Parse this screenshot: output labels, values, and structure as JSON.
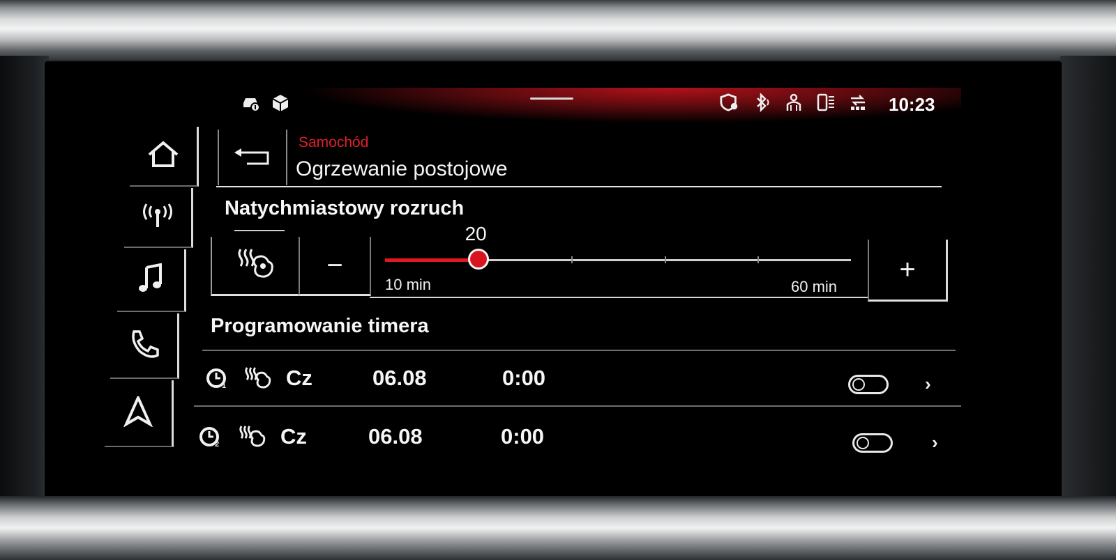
{
  "status_bar": {
    "left_icons": [
      "car-info-icon",
      "package-icon"
    ],
    "right_icons": [
      "shield-location-icon",
      "bluetooth-icon",
      "person-icon",
      "phone-signal-icon",
      "data-transfer-icon"
    ],
    "time": "10:23",
    "accent_color": "#e01822"
  },
  "nav": {
    "items": [
      {
        "icon": "home-icon"
      },
      {
        "icon": "radio-icon"
      },
      {
        "icon": "music-icon"
      },
      {
        "icon": "phone-icon"
      },
      {
        "icon": "navigation-icon"
      }
    ]
  },
  "header": {
    "breadcrumb": "Samochód",
    "title": "Ogrzewanie postojowe",
    "back_icon": "back-arrow-icon"
  },
  "instant_start": {
    "title": "Natychmiastowy rozruch",
    "mode_icon": "seat-heating-icon",
    "minus_label": "−",
    "plus_label": "+",
    "slider": {
      "value": "20",
      "value_num": 20,
      "min": 10,
      "max": 60,
      "min_label": "10 min",
      "max_label": "60 min"
    }
  },
  "timer": {
    "title": "Programowanie timera",
    "rows": [
      {
        "clock_icon": "timer-1-icon",
        "mode_icon": "seat-heating-icon",
        "day": "Cz",
        "date": "06.08",
        "time": "0:00",
        "enabled": false
      },
      {
        "clock_icon": "timer-2-icon",
        "mode_icon": "seat-heating-icon",
        "day": "Cz",
        "date": "06.08",
        "time": "0:00",
        "enabled": false
      }
    ]
  }
}
